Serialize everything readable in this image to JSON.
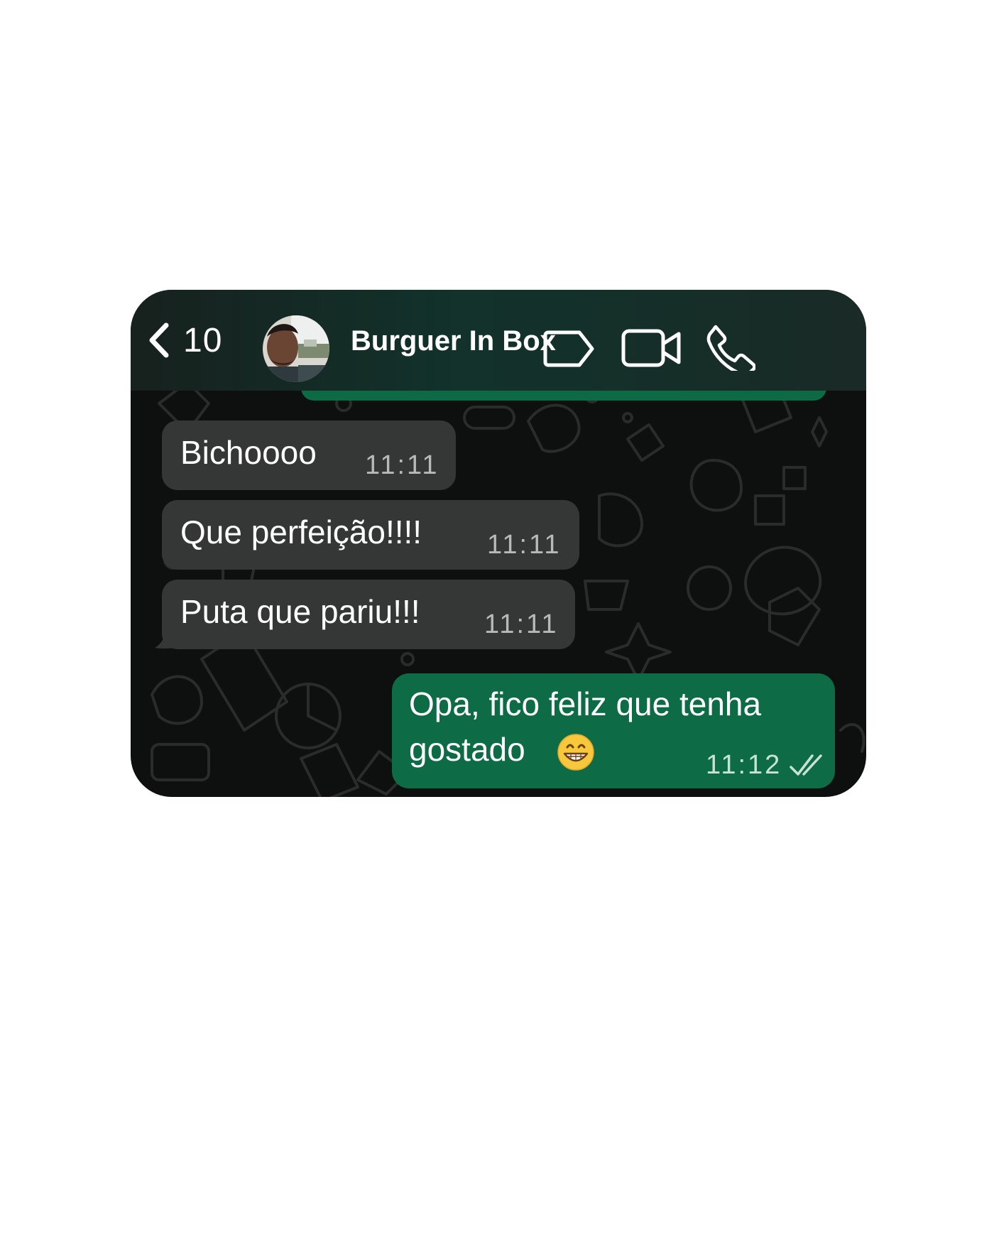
{
  "header": {
    "back_count": "10",
    "chat_title": "Burguer In Box",
    "icons": [
      "back-chevron-icon",
      "label-icon",
      "video-call-icon",
      "phone-call-icon"
    ]
  },
  "messages": [
    {
      "direction": "incoming",
      "text": "Bichoooo",
      "time": "11:11"
    },
    {
      "direction": "incoming",
      "text": "Que perfeição!!!!",
      "time": "11:11"
    },
    {
      "direction": "incoming",
      "text": "Puta que pariu!!!",
      "time": "11:11"
    },
    {
      "direction": "outgoing",
      "text_line1": "Opa, fico feliz que tenha",
      "text_line2": "gostado",
      "emoji": "😁",
      "time": "11:12",
      "status_icon": "double-check-icon"
    }
  ],
  "colors": {
    "incoming_bubble": "#353736",
    "outgoing_bubble": "#0d6b46",
    "header_bg": "#12322b",
    "chat_bg": "#0e0f0f"
  }
}
